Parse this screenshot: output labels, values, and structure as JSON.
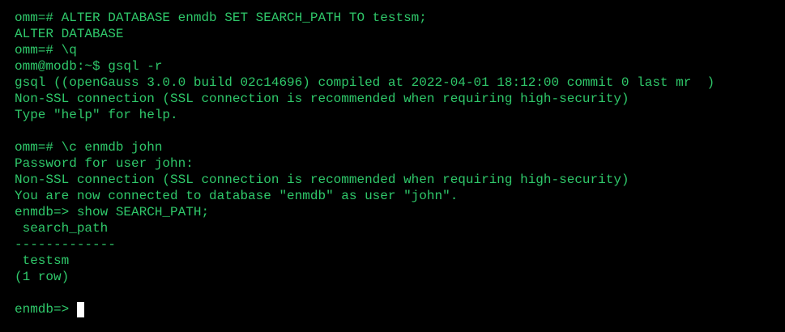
{
  "colors": {
    "background": "#000000",
    "text": "#2fc86a",
    "cursor": "#ffffff"
  },
  "terminal": {
    "lines": [
      "omm=# ALTER DATABASE enmdb SET SEARCH_PATH TO testsm;",
      "ALTER DATABASE",
      "omm=# \\q",
      "omm@modb:~$ gsql -r",
      "gsql ((openGauss 3.0.0 build 02c14696) compiled at 2022-04-01 18:12:00 commit 0 last mr  )",
      "Non-SSL connection (SSL connection is recommended when requiring high-security)",
      "Type \"help\" for help.",
      "",
      "omm=# \\c enmdb john",
      "Password for user john:",
      "Non-SSL connection (SSL connection is recommended when requiring high-security)",
      "You are now connected to database \"enmdb\" as user \"john\".",
      "enmdb=> show SEARCH_PATH;",
      " search_path",
      "-------------",
      " testsm",
      "(1 row)",
      ""
    ],
    "prompt": "enmdb=> "
  }
}
